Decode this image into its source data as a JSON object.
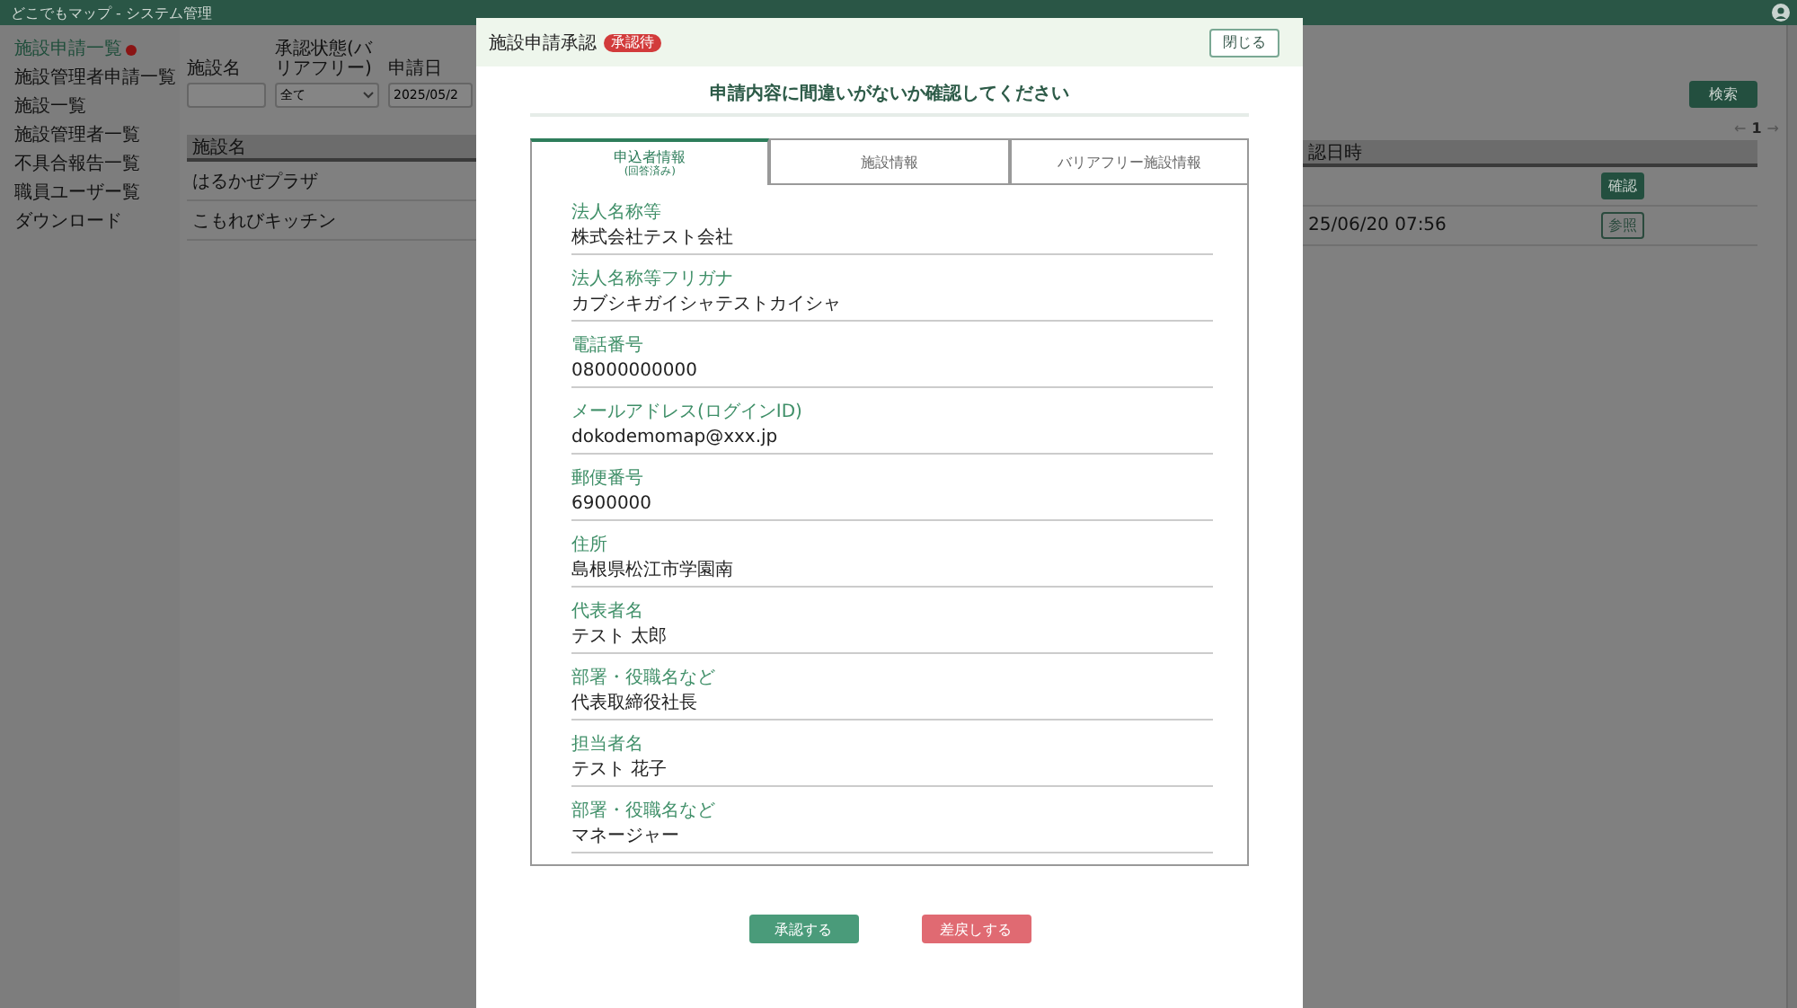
{
  "app": {
    "title": "どこでもマップ - システム管理"
  },
  "sidebar": {
    "items": [
      {
        "label": "施設申請一覧",
        "selected": true,
        "notification": true
      },
      {
        "label": "施設管理者申請一覧",
        "selected": false,
        "notification": false
      },
      {
        "label": "施設一覧",
        "selected": false,
        "notification": false
      },
      {
        "label": "施設管理者一覧",
        "selected": false,
        "notification": false
      },
      {
        "label": "不具合報告一覧",
        "selected": false,
        "notification": false
      },
      {
        "label": "職員ユーザー覧",
        "selected": false,
        "notification": false
      },
      {
        "label": "ダウンロード",
        "selected": false,
        "notification": false
      }
    ]
  },
  "filters": [
    {
      "label": "施設名",
      "kind": "text"
    },
    {
      "label": "承認状態(バリアフリー)",
      "kind": "select",
      "value": "全て"
    },
    {
      "label": "申請日",
      "kind": "date",
      "value": "2025/05/2"
    }
  ],
  "search_button": "検索",
  "pagination": {
    "prev": "←",
    "page": "1",
    "next": "→"
  },
  "table": {
    "columns": [
      "施設名",
      "認日時"
    ],
    "rows": [
      {
        "name": "はるかぜプラザ",
        "action": "確認",
        "kind": "primary"
      },
      {
        "name": "こもれびキッチン",
        "date": "25/06/20 07:56",
        "action": "参照",
        "kind": "outline"
      }
    ]
  },
  "modal": {
    "title": "施設申請承認",
    "status": "承認待",
    "close": "閉じる",
    "heading": "申請内容に間違いがないか確認してください",
    "tabs": [
      {
        "label": "申込者情報",
        "sub": "(回答済み)",
        "selected": true
      },
      {
        "label": "施設情報",
        "selected": false
      },
      {
        "label": "バリアフリー施設情報",
        "selected": false
      }
    ],
    "fields": [
      {
        "label": "法人名称等",
        "value": "株式会社テスト会社"
      },
      {
        "label": "法人名称等フリガナ",
        "value": "カブシキガイシャテストカイシャ"
      },
      {
        "label": "電話番号",
        "value": "08000000000"
      },
      {
        "label": "メールアドレス(ログインID)",
        "value": "dokodemomap@xxx.jp"
      },
      {
        "label": "郵便番号",
        "value": "6900000"
      },
      {
        "label": "住所",
        "value": "島根県松江市学園南"
      },
      {
        "label": "代表者名",
        "value": "テスト 太郎"
      },
      {
        "label": "部署・役職名など",
        "value": "代表取締役社長"
      },
      {
        "label": "担当者名",
        "value": "テスト 花子"
      },
      {
        "label": "部署・役職名など",
        "value": "マネージャー"
      }
    ],
    "actions": [
      {
        "label": "承認する",
        "kind": "approve"
      },
      {
        "label": "差戻しする",
        "kind": "reject"
      }
    ]
  }
}
